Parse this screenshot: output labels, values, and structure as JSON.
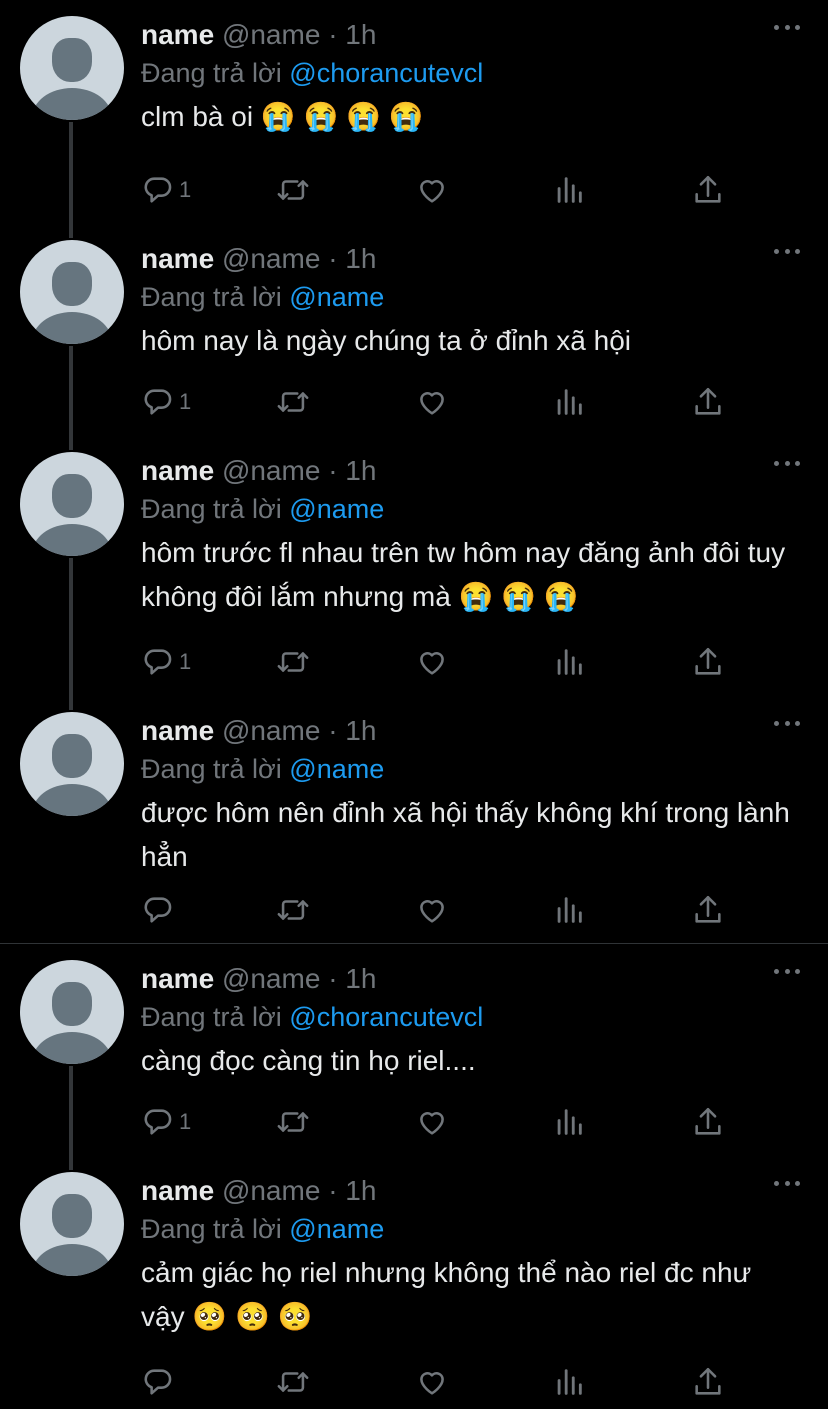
{
  "tweets": [
    {
      "name": "name",
      "handle": "@name",
      "dot": "·",
      "time": "1h",
      "reply_prefix": "Đang trả lời",
      "reply_to": "@chorancutevcl",
      "text": "clm bà oi 😭 😭 😭 😭",
      "reply_count": "1"
    },
    {
      "name": "name",
      "handle": "@name",
      "dot": "·",
      "time": "1h",
      "reply_prefix": "Đang trả lời",
      "reply_to": "@name",
      "text": "hôm nay là ngày chúng ta ở đỉnh xã hội",
      "reply_count": "1"
    },
    {
      "name": "name",
      "handle": "@name",
      "dot": "·",
      "time": "1h",
      "reply_prefix": "Đang trả lời",
      "reply_to": "@name",
      "text": "hôm trước fl nhau trên tw hôm nay đăng ảnh đôi tuy không đôi lắm nhưng mà 😭 😭 😭",
      "reply_count": "1"
    },
    {
      "name": "name",
      "handle": "@name",
      "dot": "·",
      "time": "1h",
      "reply_prefix": "Đang trả lời",
      "reply_to": "@name",
      "text": "được hôm nên đỉnh xã hội thấy không khí trong lành hẳn",
      "reply_count": ""
    },
    {
      "name": "name",
      "handle": "@name",
      "dot": "·",
      "time": "1h",
      "reply_prefix": "Đang trả lời",
      "reply_to": "@chorancutevcl",
      "text": "càng đọc càng tin họ riel....",
      "reply_count": "1"
    },
    {
      "name": "name",
      "handle": "@name",
      "dot": "·",
      "time": "1h",
      "reply_prefix": "Đang trả lời",
      "reply_to": "@name",
      "text": "cảm giác họ riel nhưng không thể nào riel đc như vậy 🥺 🥺 🥺",
      "reply_count": ""
    }
  ],
  "icons": {
    "reply": "reply-icon",
    "retweet": "retweet-icon",
    "like": "heart-icon",
    "views": "analytics-icon",
    "share": "share-icon",
    "more": "more-icon"
  },
  "colors": {
    "background": "#000000",
    "mention": "#1d9bf0",
    "muted": "#71767b",
    "text": "#e7e9ea",
    "divider": "#2f3336"
  }
}
